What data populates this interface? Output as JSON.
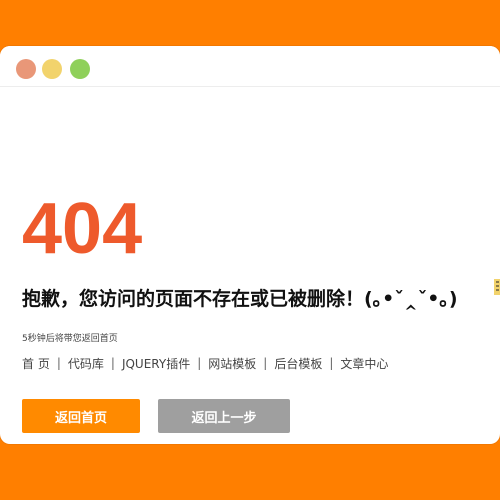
{
  "error_code": "404",
  "message": "抱歉，您访问的页面不存在或已被删除！(｡•ˇ‸ˇ•｡)",
  "countdown": "5秒钟后将带您返回首页",
  "nav": [
    "首 页",
    "代码库",
    "JQUERY插件",
    "网站模板",
    "后台模板",
    "文章中心"
  ],
  "buttons": {
    "home": "返回首页",
    "back": "返回上一步"
  },
  "colors": {
    "background": "#ff7f00",
    "error": "#ee5a2c",
    "primary_button": "#ff8a00",
    "secondary_button": "#9f9f9f",
    "window_controls": [
      "#e99778",
      "#f2d36c",
      "#8fd05a"
    ]
  }
}
